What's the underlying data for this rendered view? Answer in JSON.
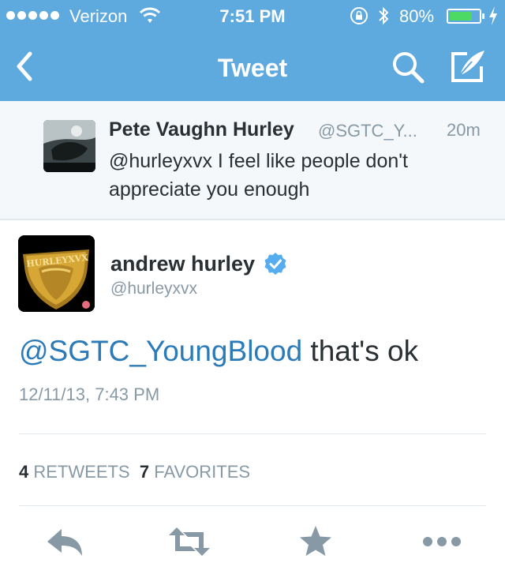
{
  "status_bar": {
    "carrier": "Verizon",
    "time": "7:51 PM",
    "battery_percent": "80%",
    "battery_level": 0.8
  },
  "nav": {
    "title": "Tweet",
    "icons": [
      "back-chevron-icon",
      "search-icon",
      "compose-icon"
    ]
  },
  "parent_tweet": {
    "name": "Pete Vaughn Hurley",
    "handle": "@SGTC_Y...",
    "time": "20m",
    "text": "@hurleyxvx I feel like people don't appreciate you enough"
  },
  "main_tweet": {
    "name": "andrew hurley",
    "handle": "@hurleyxvx",
    "verified": true,
    "mention": "@SGTC_YoungBlood",
    "text": " that's ok",
    "timestamp": "12/11/13, 7:43 PM",
    "avatar_text": "HURLEYXVX"
  },
  "stats": {
    "retweets_count": "4",
    "retweets_label": "RETWEETS",
    "favorites_count": "7",
    "favorites_label": "FAVORITES"
  },
  "actions": [
    "reply-icon",
    "retweet-icon",
    "favorite-icon",
    "more-icon"
  ],
  "colors": {
    "header_bg": "#5ea9dd",
    "link": "#2b7bb9",
    "secondary_text": "#8899a6",
    "primary_text": "#292f33",
    "action_icon": "#8899a6",
    "battery_fill": "#4cd964"
  }
}
